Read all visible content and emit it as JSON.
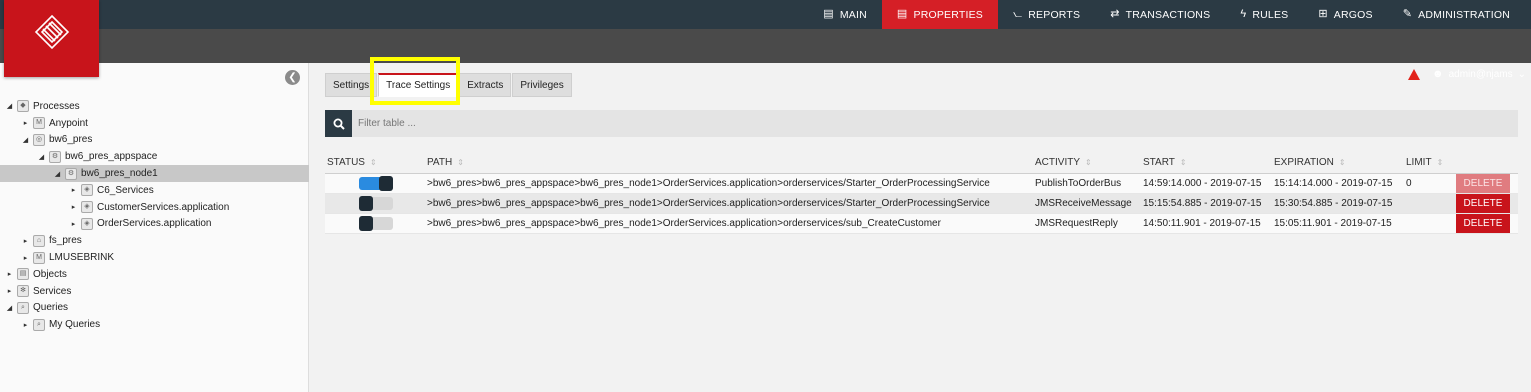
{
  "nav": {
    "items": [
      {
        "label": "MAIN",
        "icon": "main-icon",
        "glyph": "▤",
        "active": false
      },
      {
        "label": "PROPERTIES",
        "icon": "properties-icon",
        "glyph": "▤",
        "active": true
      },
      {
        "label": "REPORTS",
        "icon": "reports-icon",
        "glyph": "⦦",
        "active": false
      },
      {
        "label": "TRANSACTIONS",
        "icon": "transactions-icon",
        "glyph": "⇄",
        "active": false
      },
      {
        "label": "RULES",
        "icon": "rules-icon",
        "glyph": "ϟ",
        "active": false
      },
      {
        "label": "ARGOS",
        "icon": "argos-icon",
        "glyph": "⊞",
        "active": false
      },
      {
        "label": "ADMINISTRATION",
        "icon": "wrench-icon",
        "glyph": "✎",
        "active": false
      }
    ]
  },
  "user": {
    "name": "admin@njams"
  },
  "tree": [
    {
      "label": "Processes",
      "level": 0,
      "caret": "◢",
      "icon": "processes-icon",
      "glyph": "◆",
      "selected": false
    },
    {
      "label": "Anypoint",
      "level": 1,
      "caret": "▸",
      "icon": "mule-icon",
      "glyph": "M",
      "selected": false
    },
    {
      "label": "bw6_pres",
      "level": 1,
      "caret": "◢",
      "icon": "bw-icon",
      "glyph": "◎",
      "selected": false
    },
    {
      "label": "bw6_pres_appspace",
      "level": 2,
      "caret": "◢",
      "icon": "appspace-icon",
      "glyph": "⚙",
      "selected": false
    },
    {
      "label": "bw6_pres_node1",
      "level": 3,
      "caret": "◢",
      "icon": "node-icon",
      "glyph": "⚙",
      "selected": true
    },
    {
      "label": "C6_Services",
      "level": 4,
      "caret": "▸",
      "icon": "application-icon",
      "glyph": "◈",
      "selected": false
    },
    {
      "label": "CustomerServices.application",
      "level": 4,
      "caret": "▸",
      "icon": "application-icon",
      "glyph": "◈",
      "selected": false
    },
    {
      "label": "OrderServices.application",
      "level": 4,
      "caret": "▸",
      "icon": "application-icon",
      "glyph": "◈",
      "selected": false
    },
    {
      "label": "fs_pres",
      "level": 1,
      "caret": "▸",
      "icon": "fs-icon",
      "glyph": "⌂",
      "selected": false
    },
    {
      "label": "LMUSEBRINK",
      "level": 1,
      "caret": "▸",
      "icon": "mule-icon",
      "glyph": "M",
      "selected": false
    },
    {
      "label": "Objects",
      "level": 0,
      "caret": "▸",
      "icon": "objects-icon",
      "glyph": "▤",
      "selected": false
    },
    {
      "label": "Services",
      "level": 0,
      "caret": "▸",
      "icon": "services-icon",
      "glyph": "✻",
      "selected": false
    },
    {
      "label": "Queries",
      "level": 0,
      "caret": "◢",
      "icon": "queries-icon",
      "glyph": "⌕",
      "selected": false
    },
    {
      "label": "My Queries",
      "level": 1,
      "caret": "▸",
      "icon": "queries-icon",
      "glyph": "⌕",
      "selected": false
    }
  ],
  "tabs": [
    {
      "label": "Settings",
      "active": false
    },
    {
      "label": "Trace Settings",
      "active": true
    },
    {
      "label": "Extracts",
      "active": false
    },
    {
      "label": "Privileges",
      "active": false
    }
  ],
  "search": {
    "placeholder": "Filter table ..."
  },
  "table": {
    "columns": [
      "STATUS",
      "PATH",
      "ACTIVITY",
      "START",
      "EXPIRATION",
      "LIMIT",
      ""
    ],
    "rows": [
      {
        "status": "on",
        "path": ">bw6_pres>bw6_pres_appspace>bw6_pres_node1>OrderServices.application>orderservices/Starter_OrderProcessingService",
        "activity": "PublishToOrderBus",
        "start": "14:59:14.000 - 2019-07-15",
        "expiration": "15:14:14.000 - 2019-07-15",
        "limit": "0",
        "action": "DELETE",
        "muted": true
      },
      {
        "status": "off",
        "path": ">bw6_pres>bw6_pres_appspace>bw6_pres_node1>OrderServices.application>orderservices/Starter_OrderProcessingService",
        "activity": "JMSReceiveMessage",
        "start": "15:15:54.885 - 2019-07-15",
        "expiration": "15:30:54.885 - 2019-07-15",
        "limit": "",
        "action": "DELETE",
        "muted": false
      },
      {
        "status": "off",
        "path": ">bw6_pres>bw6_pres_appspace>bw6_pres_node1>OrderServices.application>orderservices/sub_CreateCustomer",
        "activity": "JMSRequestReply",
        "start": "14:50:11.901 - 2019-07-15",
        "expiration": "15:05:11.901 - 2019-07-15",
        "limit": "",
        "action": "DELETE",
        "muted": false
      }
    ]
  },
  "colors": {
    "brand": "#c8141b",
    "topbar": "#2b3a44",
    "subbar": "#4a4a4a",
    "highlight": "#ffff00",
    "toggle_on": "#2a8be0"
  }
}
